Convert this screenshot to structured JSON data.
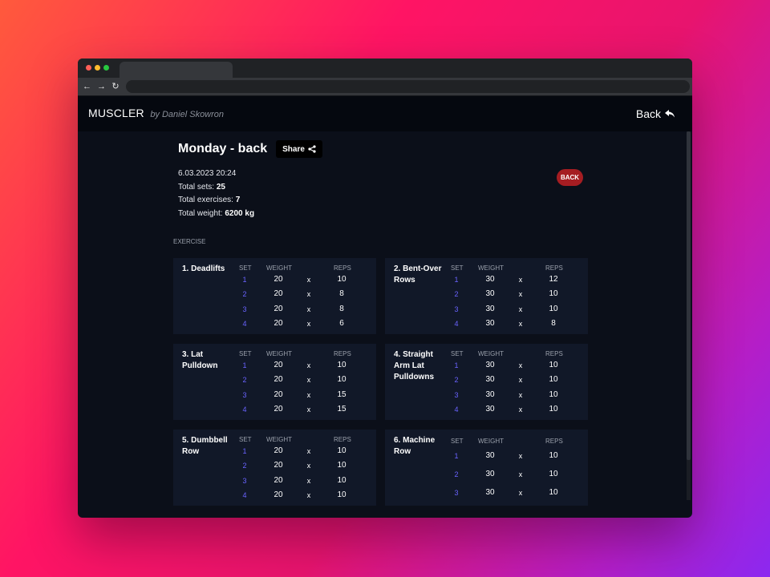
{
  "app": {
    "brand": "MUSCLER",
    "brand_by": "by Daniel Skowron",
    "back_label": "Back"
  },
  "workout": {
    "title": "Monday - back",
    "share_label": "Share",
    "date": "6.03.2023 20:24",
    "total_sets_label": "Total sets:",
    "total_sets": "25",
    "total_exercises_label": "Total exercises:",
    "total_exercises": "7",
    "total_weight_label": "Total weight:",
    "total_weight": "6200 kg",
    "badge": "BACK",
    "section_label": "EXERCISE"
  },
  "headers": {
    "set": "SET",
    "weight": "WEIGHT",
    "reps": "REPS"
  },
  "times": "x",
  "exercises": [
    {
      "name": "1. Deadlifts",
      "sets": [
        {
          "set": "1",
          "weight": "20",
          "reps": "10"
        },
        {
          "set": "2",
          "weight": "20",
          "reps": "8"
        },
        {
          "set": "3",
          "weight": "20",
          "reps": "8"
        },
        {
          "set": "4",
          "weight": "20",
          "reps": "6"
        }
      ]
    },
    {
      "name": "2. Bent-Over Rows",
      "sets": [
        {
          "set": "1",
          "weight": "30",
          "reps": "12"
        },
        {
          "set": "2",
          "weight": "30",
          "reps": "10"
        },
        {
          "set": "3",
          "weight": "30",
          "reps": "10"
        },
        {
          "set": "4",
          "weight": "30",
          "reps": "8"
        }
      ]
    },
    {
      "name": "3. Lat Pulldown",
      "sets": [
        {
          "set": "1",
          "weight": "20",
          "reps": "10"
        },
        {
          "set": "2",
          "weight": "20",
          "reps": "10"
        },
        {
          "set": "3",
          "weight": "20",
          "reps": "15"
        },
        {
          "set": "4",
          "weight": "20",
          "reps": "15"
        }
      ]
    },
    {
      "name": "4. Straight Arm Lat Pulldowns",
      "sets": [
        {
          "set": "1",
          "weight": "30",
          "reps": "10"
        },
        {
          "set": "2",
          "weight": "30",
          "reps": "10"
        },
        {
          "set": "3",
          "weight": "30",
          "reps": "10"
        },
        {
          "set": "4",
          "weight": "30",
          "reps": "10"
        }
      ]
    },
    {
      "name": "5. Dumbbell Row",
      "sets": [
        {
          "set": "1",
          "weight": "20",
          "reps": "10"
        },
        {
          "set": "2",
          "weight": "20",
          "reps": "10"
        },
        {
          "set": "3",
          "weight": "20",
          "reps": "10"
        },
        {
          "set": "4",
          "weight": "20",
          "reps": "10"
        }
      ]
    },
    {
      "name": "6. Machine Row",
      "sets": [
        {
          "set": "1",
          "weight": "30",
          "reps": "10"
        },
        {
          "set": "2",
          "weight": "30",
          "reps": "10"
        },
        {
          "set": "3",
          "weight": "30",
          "reps": "10"
        }
      ]
    }
  ]
}
